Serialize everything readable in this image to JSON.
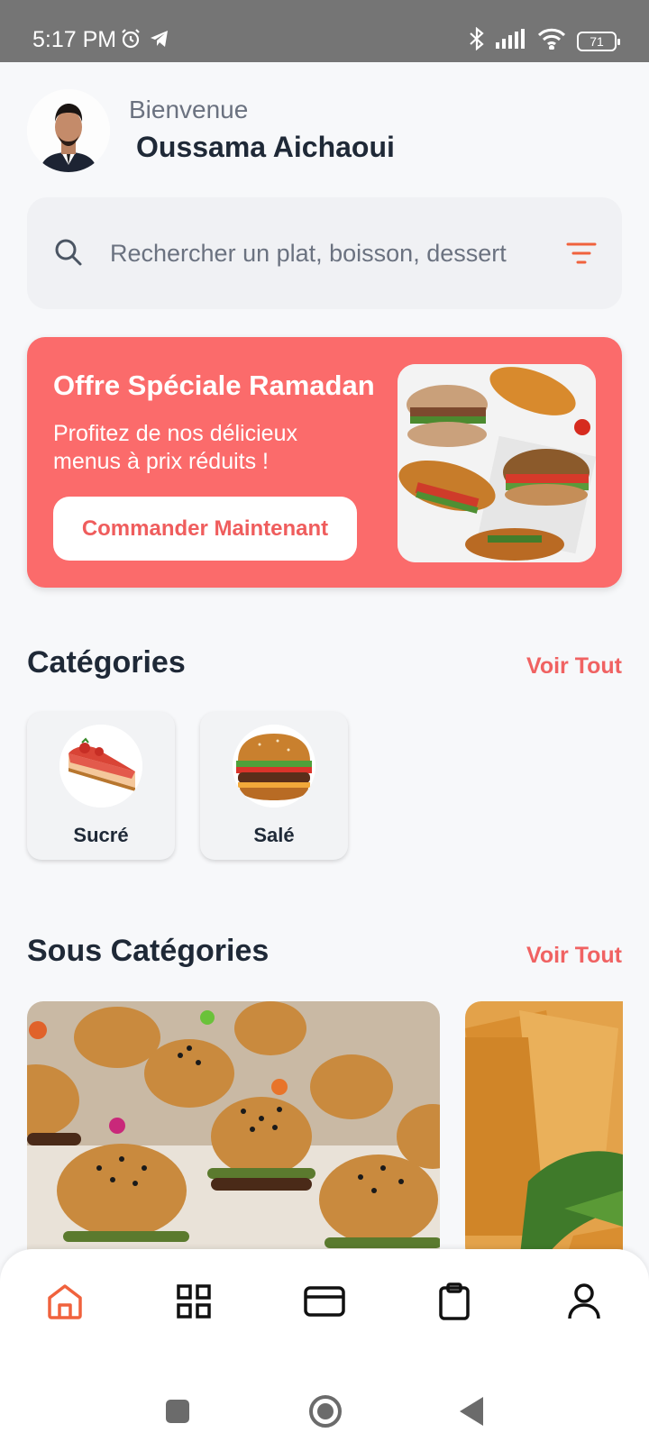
{
  "status_bar": {
    "time": "5:17 PM",
    "battery": "71",
    "icons": [
      "alarm-icon",
      "telegram-icon",
      "bluetooth-icon",
      "signal-icon",
      "wifi-icon",
      "battery-icon"
    ]
  },
  "header": {
    "greeting": "Bienvenue",
    "user_name": "Oussama Aichaoui"
  },
  "search": {
    "placeholder": "Rechercher un plat, boisson, dessert"
  },
  "promo": {
    "title": "Offre Spéciale Ramadan",
    "text": "Profitez de nos délicieux menus à prix réduits !",
    "button_label": "Commander Maintenant"
  },
  "categories": {
    "title": "Catégories",
    "see_all": "Voir Tout",
    "items": [
      {
        "label": "Sucré"
      },
      {
        "label": "Salé"
      }
    ]
  },
  "sub_categories": {
    "title": "Sous Catégories",
    "see_all": "Voir Tout"
  },
  "bottom_nav": {
    "active": "home",
    "items": [
      "home-icon",
      "grid-icon",
      "card-icon",
      "clipboard-icon",
      "user-icon"
    ]
  },
  "colors": {
    "accent": "#fb6b6b",
    "accent_text": "#f06262",
    "active_nav": "#f0623d",
    "background": "#f7f8fa"
  }
}
